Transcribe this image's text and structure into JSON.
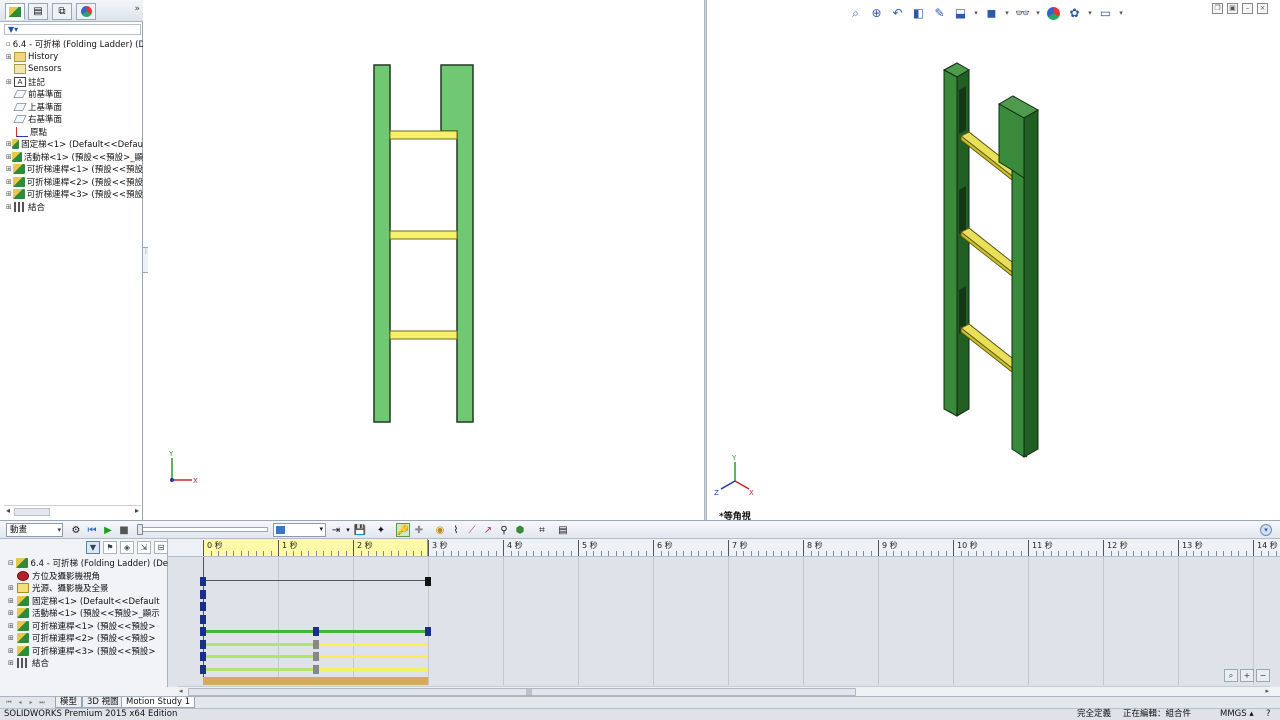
{
  "tree": {
    "filter_icon": "filter-icon",
    "items": [
      {
        "label": "6.4 - 可折梯 (Folding Ladder)  (D",
        "icon": "assembly-icon",
        "expander": "▫"
      },
      {
        "label": "History",
        "icon": "history-folder-icon",
        "expander": "⊞"
      },
      {
        "label": "Sensors",
        "icon": "sensor-icon",
        "expander": ""
      },
      {
        "label": "註記",
        "icon": "annotation-icon",
        "expander": "⊞"
      },
      {
        "label": "前基準面",
        "icon": "plane-icon",
        "expander": ""
      },
      {
        "label": "上基準面",
        "icon": "plane-icon",
        "expander": ""
      },
      {
        "label": "右基準面",
        "icon": "plane-icon",
        "expander": ""
      },
      {
        "label": "原點",
        "icon": "origin-icon",
        "expander": ""
      },
      {
        "label": "固定梯<1> (Default<<Defau",
        "icon": "part-icon",
        "expander": "⊞"
      },
      {
        "label": "活動梯<1> (預設<<預設>_顯",
        "icon": "part-icon",
        "expander": "⊞"
      },
      {
        "label": "可折梯連桿<1> (預設<<預設",
        "icon": "part-icon",
        "expander": "⊞"
      },
      {
        "label": "可折梯連桿<2> (預設<<預設",
        "icon": "part-icon",
        "expander": "⊞"
      },
      {
        "label": "可折梯連桿<3> (預設<<預設",
        "icon": "part-icon",
        "expander": "⊞"
      },
      {
        "label": "結合",
        "icon": "mates-icon",
        "expander": "⊞"
      }
    ]
  },
  "viewport_right": {
    "view_label": "*等角視"
  },
  "colors": {
    "rail_light": "#70c972",
    "rail_dark": "#2e7d35",
    "rung_light": "#f6f16a",
    "rung_dark": "#d8cf2c",
    "key_green": "#3fb43f",
    "key_lime": "#b5e46a",
    "key_yellow": "#f5ef5c",
    "key_mates": "#d4aa5c"
  },
  "motion": {
    "study_type": "動畫",
    "study_type_options": [
      "動畫"
    ],
    "tree_items": [
      {
        "label": "6.4 - 可折梯 (Folding Ladder)  (De",
        "icon": "assembly-icon",
        "expander": "⊟"
      },
      {
        "label": "方位及攝影機視角",
        "icon": "camera-icon",
        "expander": ""
      },
      {
        "label": "光源、攝影機及全景",
        "icon": "light-icon",
        "expander": "⊞"
      },
      {
        "label": "固定梯<1> (Default<<Default",
        "icon": "part-icon",
        "expander": "⊞"
      },
      {
        "label": "活動梯<1> (預設<<預設>_顯示",
        "icon": "part-icon",
        "expander": "⊞"
      },
      {
        "label": "可折梯連桿<1> (預設<<預設>",
        "icon": "part-icon",
        "expander": "⊞"
      },
      {
        "label": "可折梯連桿<2> (預設<<預設>",
        "icon": "part-icon",
        "expander": "⊞"
      },
      {
        "label": "可折梯連桿<3> (預設<<預設>",
        "icon": "part-icon",
        "expander": "⊞"
      },
      {
        "label": "結合",
        "icon": "mates-icon",
        "expander": "⊞"
      }
    ],
    "time_labels": [
      "0 秒",
      "1 秒",
      "2 秒",
      "3 秒",
      "4 秒",
      "5 秒",
      "6 秒",
      "7 秒",
      "8 秒",
      "9 秒",
      "10 秒",
      "11 秒",
      "12 秒",
      "13 秒",
      "14 秒"
    ],
    "current_time_seconds": 0,
    "animation_end_seconds": 3,
    "keyframes": [
      {
        "row": "assembly",
        "times": [
          0,
          3
        ],
        "bar_color": "#555555"
      },
      {
        "row": "camera",
        "times": [
          0
        ],
        "bar_color": null
      },
      {
        "row": "lights",
        "times": [
          0
        ],
        "bar_color": null
      },
      {
        "row": "fixed-ladder",
        "times": [
          0
        ],
        "bar_color": null
      },
      {
        "row": "moving-ladder",
        "times": [
          0,
          1.5,
          3
        ],
        "bar_color": "#3fb43f"
      },
      {
        "row": "link-1",
        "times": [
          0,
          1.5
        ],
        "bar_color": "#b5e46a",
        "tail_color": "#f5ef5c"
      },
      {
        "row": "link-2",
        "times": [
          0,
          1.5
        ],
        "bar_color": "#b5e46a",
        "tail_color": "#f5ef5c"
      },
      {
        "row": "link-3",
        "times": [
          0,
          1.5
        ],
        "bar_color": "#b5e46a",
        "tail_color": "#f5ef5c"
      },
      {
        "row": "mates",
        "times": [],
        "bar_color": "#d4aa5c"
      }
    ]
  },
  "bottom_tabs": [
    "模型",
    "3D 視圖",
    "Motion Study 1"
  ],
  "status": {
    "edition": "SOLIDWORKS Premium 2015 x64 Edition",
    "definition": "完全定義",
    "editing": "正在編輯：組合件",
    "units": "MMGS"
  }
}
